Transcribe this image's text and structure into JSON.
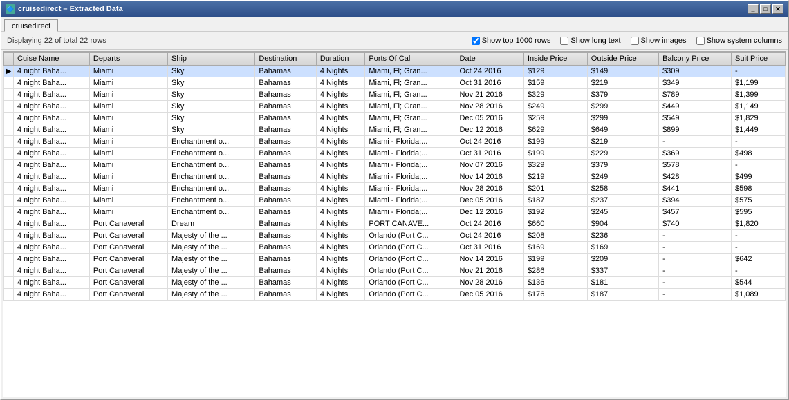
{
  "window": {
    "title": "cruisedirect – Extracted Data",
    "icon": "🚢"
  },
  "titleControls": [
    "_",
    "□",
    "✕"
  ],
  "tab": {
    "label": "cruisedirect"
  },
  "toolbar": {
    "display_text": "Displaying 22 of total 22 rows",
    "checkboxes": [
      {
        "id": "show1000",
        "label": "Show top 1000 rows",
        "checked": true
      },
      {
        "id": "showLong",
        "label": "Show long text",
        "checked": false
      },
      {
        "id": "showImages",
        "label": "Show images",
        "checked": false
      },
      {
        "id": "showSystem",
        "label": "Show system columns",
        "checked": false
      }
    ]
  },
  "table": {
    "columns": [
      {
        "id": "cuise_name",
        "label": "Cuise Name"
      },
      {
        "id": "departs",
        "label": "Departs"
      },
      {
        "id": "ship",
        "label": "Ship"
      },
      {
        "id": "destination",
        "label": "Destination"
      },
      {
        "id": "duration",
        "label": "Duration"
      },
      {
        "id": "ports_of_call",
        "label": "Ports Of Call"
      },
      {
        "id": "date",
        "label": "Date"
      },
      {
        "id": "inside_price",
        "label": "Inside Price"
      },
      {
        "id": "outside_price",
        "label": "Outside Price"
      },
      {
        "id": "balcony_price",
        "label": "Balcony Price"
      },
      {
        "id": "suit_price",
        "label": "Suit Price"
      }
    ],
    "rows": [
      {
        "selected": true,
        "cuise_name": "4 night Baha...",
        "departs": "Miami",
        "ship": "Sky",
        "destination": "Bahamas",
        "duration": "4 Nights",
        "ports_of_call": "Miami, Fl; Gran...",
        "date": "Oct 24 2016",
        "inside_price": "$129",
        "outside_price": "$149",
        "balcony_price": "$309",
        "suit_price": "-"
      },
      {
        "selected": false,
        "cuise_name": "4 night Baha...",
        "departs": "Miami",
        "ship": "Sky",
        "destination": "Bahamas",
        "duration": "4 Nights",
        "ports_of_call": "Miami, Fl; Gran...",
        "date": "Oct 31 2016",
        "inside_price": "$159",
        "outside_price": "$219",
        "balcony_price": "$349",
        "suit_price": "$1,199"
      },
      {
        "selected": false,
        "cuise_name": "4 night Baha...",
        "departs": "Miami",
        "ship": "Sky",
        "destination": "Bahamas",
        "duration": "4 Nights",
        "ports_of_call": "Miami, Fl; Gran...",
        "date": "Nov 21 2016",
        "inside_price": "$329",
        "outside_price": "$379",
        "balcony_price": "$789",
        "suit_price": "$1,399"
      },
      {
        "selected": false,
        "cuise_name": "4 night Baha...",
        "departs": "Miami",
        "ship": "Sky",
        "destination": "Bahamas",
        "duration": "4 Nights",
        "ports_of_call": "Miami, Fl; Gran...",
        "date": "Nov 28 2016",
        "inside_price": "$249",
        "outside_price": "$299",
        "balcony_price": "$449",
        "suit_price": "$1,149"
      },
      {
        "selected": false,
        "cuise_name": "4 night Baha...",
        "departs": "Miami",
        "ship": "Sky",
        "destination": "Bahamas",
        "duration": "4 Nights",
        "ports_of_call": "Miami, Fl; Gran...",
        "date": "Dec 05 2016",
        "inside_price": "$259",
        "outside_price": "$299",
        "balcony_price": "$549",
        "suit_price": "$1,829"
      },
      {
        "selected": false,
        "cuise_name": "4 night Baha...",
        "departs": "Miami",
        "ship": "Sky",
        "destination": "Bahamas",
        "duration": "4 Nights",
        "ports_of_call": "Miami, Fl; Gran...",
        "date": "Dec 12 2016",
        "inside_price": "$629",
        "outside_price": "$649",
        "balcony_price": "$899",
        "suit_price": "$1,449"
      },
      {
        "selected": false,
        "cuise_name": "4 night Baha...",
        "departs": "Miami",
        "ship": "Enchantment o...",
        "destination": "Bahamas",
        "duration": "4 Nights",
        "ports_of_call": "Miami - Florida;...",
        "date": "Oct 24 2016",
        "inside_price": "$199",
        "outside_price": "$219",
        "balcony_price": "-",
        "suit_price": "-"
      },
      {
        "selected": false,
        "cuise_name": "4 night Baha...",
        "departs": "Miami",
        "ship": "Enchantment o...",
        "destination": "Bahamas",
        "duration": "4 Nights",
        "ports_of_call": "Miami - Florida;...",
        "date": "Oct 31 2016",
        "inside_price": "$199",
        "outside_price": "$229",
        "balcony_price": "$369",
        "suit_price": "$498"
      },
      {
        "selected": false,
        "cuise_name": "4 night Baha...",
        "departs": "Miami",
        "ship": "Enchantment o...",
        "destination": "Bahamas",
        "duration": "4 Nights",
        "ports_of_call": "Miami - Florida;...",
        "date": "Nov 07 2016",
        "inside_price": "$329",
        "outside_price": "$379",
        "balcony_price": "$578",
        "suit_price": "-"
      },
      {
        "selected": false,
        "cuise_name": "4 night Baha...",
        "departs": "Miami",
        "ship": "Enchantment o...",
        "destination": "Bahamas",
        "duration": "4 Nights",
        "ports_of_call": "Miami - Florida;...",
        "date": "Nov 14 2016",
        "inside_price": "$219",
        "outside_price": "$249",
        "balcony_price": "$428",
        "suit_price": "$499"
      },
      {
        "selected": false,
        "cuise_name": "4 night Baha...",
        "departs": "Miami",
        "ship": "Enchantment o...",
        "destination": "Bahamas",
        "duration": "4 Nights",
        "ports_of_call": "Miami - Florida;...",
        "date": "Nov 28 2016",
        "inside_price": "$201",
        "outside_price": "$258",
        "balcony_price": "$441",
        "suit_price": "$598"
      },
      {
        "selected": false,
        "cuise_name": "4 night Baha...",
        "departs": "Miami",
        "ship": "Enchantment o...",
        "destination": "Bahamas",
        "duration": "4 Nights",
        "ports_of_call": "Miami - Florida;...",
        "date": "Dec 05 2016",
        "inside_price": "$187",
        "outside_price": "$237",
        "balcony_price": "$394",
        "suit_price": "$575"
      },
      {
        "selected": false,
        "cuise_name": "4 night Baha...",
        "departs": "Miami",
        "ship": "Enchantment o...",
        "destination": "Bahamas",
        "duration": "4 Nights",
        "ports_of_call": "Miami - Florida;...",
        "date": "Dec 12 2016",
        "inside_price": "$192",
        "outside_price": "$245",
        "balcony_price": "$457",
        "suit_price": "$595"
      },
      {
        "selected": false,
        "cuise_name": "4 night Baha...",
        "departs": "Port Canaveral",
        "ship": "Dream",
        "destination": "Bahamas",
        "duration": "4 Nights",
        "ports_of_call": "PORT CANAVE...",
        "date": "Oct 24 2016",
        "inside_price": "$660",
        "outside_price": "$904",
        "balcony_price": "$740",
        "suit_price": "$1,820"
      },
      {
        "selected": false,
        "cuise_name": "4 night Baha...",
        "departs": "Port Canaveral",
        "ship": "Majesty of the ...",
        "destination": "Bahamas",
        "duration": "4 Nights",
        "ports_of_call": "Orlando (Port C...",
        "date": "Oct 24 2016",
        "inside_price": "$208",
        "outside_price": "$236",
        "balcony_price": "-",
        "suit_price": "-"
      },
      {
        "selected": false,
        "cuise_name": "4 night Baha...",
        "departs": "Port Canaveral",
        "ship": "Majesty of the ...",
        "destination": "Bahamas",
        "duration": "4 Nights",
        "ports_of_call": "Orlando (Port C...",
        "date": "Oct 31 2016",
        "inside_price": "$169",
        "outside_price": "$169",
        "balcony_price": "-",
        "suit_price": "-"
      },
      {
        "selected": false,
        "cuise_name": "4 night Baha...",
        "departs": "Port Canaveral",
        "ship": "Majesty of the ...",
        "destination": "Bahamas",
        "duration": "4 Nights",
        "ports_of_call": "Orlando (Port C...",
        "date": "Nov 14 2016",
        "inside_price": "$199",
        "outside_price": "$209",
        "balcony_price": "-",
        "suit_price": "$642"
      },
      {
        "selected": false,
        "cuise_name": "4 night Baha...",
        "departs": "Port Canaveral",
        "ship": "Majesty of the ...",
        "destination": "Bahamas",
        "duration": "4 Nights",
        "ports_of_call": "Orlando (Port C...",
        "date": "Nov 21 2016",
        "inside_price": "$286",
        "outside_price": "$337",
        "balcony_price": "-",
        "suit_price": "-"
      },
      {
        "selected": false,
        "cuise_name": "4 night Baha...",
        "departs": "Port Canaveral",
        "ship": "Majesty of the ...",
        "destination": "Bahamas",
        "duration": "4 Nights",
        "ports_of_call": "Orlando (Port C...",
        "date": "Nov 28 2016",
        "inside_price": "$136",
        "outside_price": "$181",
        "balcony_price": "-",
        "suit_price": "$544"
      },
      {
        "selected": false,
        "cuise_name": "4 night Baha...",
        "departs": "Port Canaveral",
        "ship": "Majesty of the ...",
        "destination": "Bahamas",
        "duration": "4 Nights",
        "ports_of_call": "Orlando (Port C...",
        "date": "Dec 05 2016",
        "inside_price": "$176",
        "outside_price": "$187",
        "balcony_price": "-",
        "suit_price": "$1,089"
      }
    ]
  }
}
